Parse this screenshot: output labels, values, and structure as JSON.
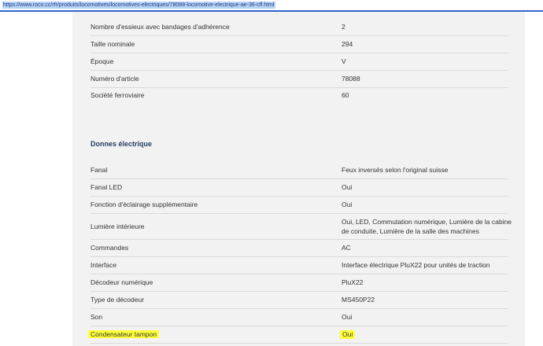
{
  "browser": {
    "url": "https://www.roco.cc/rfr/produits/locomotives/locomotives-electriques/78088-locomotive-electrique-ae-36-cff.html"
  },
  "general_specs": [
    {
      "label": "Nombre d'essieux avec bandages d'adhérence",
      "value": "2"
    },
    {
      "label": "Taille nominale",
      "value": "294"
    },
    {
      "label": "Époque",
      "value": "V"
    },
    {
      "label": "Numéro d'article",
      "value": "78088"
    },
    {
      "label": "Société ferroviaire",
      "value": "60"
    }
  ],
  "electric_section": {
    "title": "Donnes électrique",
    "specs": [
      {
        "label": "Fanal",
        "value": "Feux inversés selon l'original suisse"
      },
      {
        "label": "Fanal LED",
        "value": "Oui"
      },
      {
        "label": "Fonction d'éclairage supplémentaire",
        "value": "Oui"
      },
      {
        "label": "Lumière intérieure",
        "value_line1": "Oui, LED, Commutation numérique, Lumière de la cabine",
        "value_line2": "de conduite, Lumière de la salle des machines"
      },
      {
        "label": "Commandes",
        "value": "AC"
      },
      {
        "label": "Interface",
        "value": "Interface électrique PluX22 pour unités de traction"
      },
      {
        "label": "Décodeur numérique",
        "value": "PluX22"
      },
      {
        "label": "Type de décodeur",
        "value": "MS450P22"
      },
      {
        "label": "Son",
        "value": "Oui"
      },
      {
        "label": "Condensateur tampon",
        "value": "Oui"
      }
    ]
  },
  "colors": {
    "highlight": "#ffff3a",
    "panel_background": "#f2f2f2",
    "section_title": "#1f3a5f"
  }
}
